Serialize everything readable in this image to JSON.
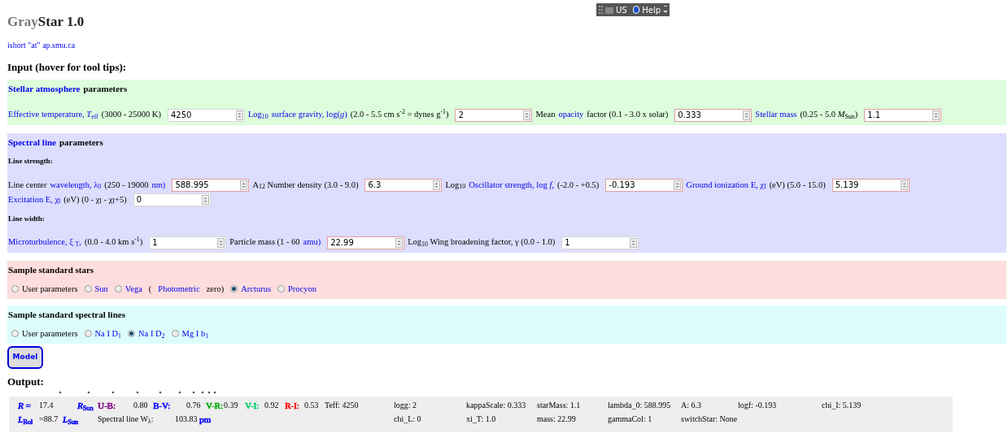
{
  "title": [
    {
      "text": "Gray",
      "faded": true
    },
    {
      "text": "Star 1.0",
      "faded": false
    }
  ],
  "toolbar": {
    "language": "US",
    "help": "Help"
  },
  "contact": "ishort \"at\" ap.smu.ca",
  "input_heading": "Input (hover for tool tips):",
  "sections": [
    {
      "kind": "fields",
      "heading": [
        {
          "text": "Stellar atmosphere",
          "link": true
        },
        {
          "text": "parameters",
          "link": false
        }
      ],
      "groups": [
        {
          "fields": [
            {
              "label": [
                {
                  "text": "Effective temperature, *T*$_{eff}$",
                  "link": true
                },
                {
                  "text": "(3000 - 25000 K)",
                  "link": false
                }
              ],
              "value": "4250",
              "flagged": false
            },
            {
              "label": [
                {
                  "text": "Log$_{10}$",
                  "link": true
                },
                {
                  "text": "surface gravity, log(*g*)",
                  "link": true
                },
                {
                  "text": "(2.0 - 5.5 cm s$^{-2}$ = dynes g$^{-1}$)",
                  "link": false
                }
              ],
              "value": "2",
              "flagged": true
            },
            {
              "label": [
                {
                  "text": "Mean",
                  "link": false
                },
                {
                  "text": "opacity",
                  "link": true
                },
                {
                  "text": "factor (0.1 - 3.0 x solar)",
                  "link": false
                }
              ],
              "value": "0.333",
              "flagged": true
            },
            {
              "label": [
                {
                  "text": "Stellar mass",
                  "link": true
                },
                {
                  "text": "(0.25 - 5.0 *M*$_{Sun}$)",
                  "link": false
                }
              ],
              "value": "1.1",
              "flagged": true
            }
          ]
        }
      ]
    },
    {
      "kind": "fields",
      "heading": [
        {
          "text": "Spectral line",
          "link": true
        },
        {
          "text": "parameters",
          "link": false
        }
      ],
      "groups": [
        {
          "subheading": "Line strength:",
          "fields": [
            {
              "label": [
                {
                  "text": "Line center",
                  "link": false
                },
                {
                  "text": "wavelength, λ$_{0}$",
                  "link": true
                },
                {
                  "text": "(250 - 19000",
                  "link": false
                },
                {
                  "text": "nm)",
                  "link": true
                }
              ],
              "value": "588.995",
              "flagged": true
            },
            {
              "label": [
                {
                  "text": "A$_{12}$ Number density (3.0 - 9.0)",
                  "link": false
                }
              ],
              "value": "6.3",
              "flagged": true
            },
            {
              "label": [
                {
                  "text": "Log$_{10}$",
                  "link": false
                },
                {
                  "text": "Oscillator strength, log *f*,",
                  "link": true
                },
                {
                  "text": "(-2.0 - +0.5)",
                  "link": false
                }
              ],
              "value": "-0.193",
              "flagged": true
            },
            {
              "label": [
                {
                  "text": "Ground ionization E, χ$_{I}$",
                  "link": true
                },
                {
                  "text": "(eV) (5.0 - 15.0)",
                  "link": false
                }
              ],
              "value": "5.139",
              "flagged": true
            },
            {
              "label": [
                {
                  "text": "Excitation E, χ$_{l}$",
                  "link": true
                },
                {
                  "text": "(eV) (0 - χ$_{I}$ - χ$_{I}$+5)",
                  "link": false
                }
              ],
              "value": "0",
              "flagged": false
            }
          ]
        },
        {
          "subheading": "Line width:",
          "fields": [
            {
              "label": [
                {
                  "text": "Microturbulence, ξ $_{T}$,",
                  "link": true
                },
                {
                  "text": "(0.0 - 4.0 km s$^{-1}$)",
                  "link": false
                }
              ],
              "value": "1",
              "flagged": false
            },
            {
              "label": [
                {
                  "text": "Particle mass (1 - 60",
                  "link": false
                },
                {
                  "text": "amu)",
                  "link": true
                }
              ],
              "value": "22.99",
              "flagged": true
            },
            {
              "label": [
                {
                  "text": "Log$_{10}$ Wing broadening factor, γ (0.0 - 1.0)",
                  "link": false
                }
              ],
              "value": "1",
              "flagged": false
            }
          ]
        }
      ]
    },
    {
      "kind": "radios",
      "heading": [
        {
          "text": "Sample standard stars",
          "link": false
        }
      ],
      "options": [
        {
          "label": [
            {
              "text": "User parameters",
              "link": false
            }
          ],
          "selected": false
        },
        {
          "label": [
            {
              "text": "Sun",
              "link": true
            }
          ],
          "selected": false
        },
        {
          "label": [
            {
              "text": "Vega",
              "link": true
            },
            {
              "text": "(",
              "link": false
            },
            {
              "text": "Photometric",
              "link": true
            },
            {
              "text": "zero)",
              "link": false
            }
          ],
          "selected": false
        },
        {
          "label": [
            {
              "text": "Arcturus",
              "link": true
            }
          ],
          "selected": true
        },
        {
          "label": [
            {
              "text": "Procyon",
              "link": true
            }
          ],
          "selected": false
        }
      ]
    },
    {
      "kind": "radios",
      "heading": [
        {
          "text": "Sample standard spectral lines",
          "link": false
        }
      ],
      "options": [
        {
          "label": [
            {
              "text": "User parameters",
              "link": false
            }
          ],
          "selected": false
        },
        {
          "label": [
            {
              "text": "Na I D$_{1}$",
              "link": true
            }
          ],
          "selected": false
        },
        {
          "label": [
            {
              "text": "Na I D$_{2}$",
              "link": true
            }
          ],
          "selected": true
        },
        {
          "label": [
            {
              "text": "Mg I b$_{1}$",
              "link": true
            }
          ],
          "selected": false
        }
      ]
    }
  ],
  "model_button": "Model",
  "output_heading": "Output:",
  "output": {
    "left_rows": [
      [
        {
          "text": "*R* =",
          "color": "#0000ff"
        },
        {
          "text": "17.4"
        },
        {
          "text": "*R*$_{Sun}$",
          "color": "#0000ff"
        },
        {
          "text": "U-B:",
          "color": "#800080"
        },
        {
          "text": "0.80"
        },
        {
          "text": "B-V:",
          "color": "#0000ff"
        },
        {
          "text": "0.76"
        },
        {
          "text": "V-R:",
          "color": "#00aa00"
        },
        {
          "text": "0.39"
        },
        {
          "text": "V-I:",
          "color": "#00cc66"
        },
        {
          "text": "0.92"
        },
        {
          "text": "R-I:",
          "color": "#ff0000"
        },
        {
          "text": "0.53"
        }
      ],
      [
        {
          "text": "*L*$_{Bol}$",
          "color": "#0000ff"
        },
        {
          "text": "=88.7"
        },
        {
          "text": "*L*$_{Sun}$",
          "color": "#0000ff"
        },
        {
          "text": "Spectral line W$_{λ}$:"
        },
        {
          "text": "103.83"
        },
        {
          "text": "pm",
          "color": "#0000ff"
        }
      ]
    ],
    "param_rows": [
      [
        "Teff: 4250",
        "logg: 2",
        "kappaScale: 0.333",
        "starMass: 1.1",
        "lambda_0: 588.995",
        "A: 6.3",
        "logf: -0.193",
        "chi_I: 5.139"
      ],
      [
        "chi_L: 0",
        "xi_T: 1.0",
        "mass: 22.99",
        "gammaCol: 1",
        "switchStar: None"
      ]
    ]
  }
}
